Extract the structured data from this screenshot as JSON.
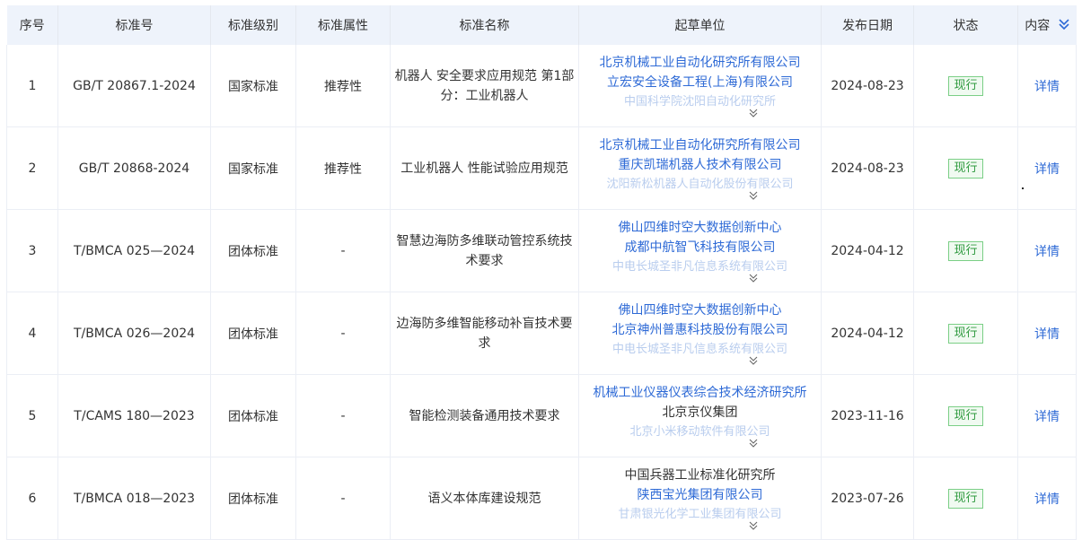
{
  "columns": [
    {
      "key": "index",
      "label": "序号"
    },
    {
      "key": "code",
      "label": "标准号"
    },
    {
      "key": "level",
      "label": "标准级别"
    },
    {
      "key": "attr",
      "label": "标准属性"
    },
    {
      "key": "name",
      "label": "标准名称"
    },
    {
      "key": "drafters",
      "label": "起草单位"
    },
    {
      "key": "date",
      "label": "发布日期"
    },
    {
      "key": "status",
      "label": "状态"
    },
    {
      "key": "content",
      "label": "内容"
    }
  ],
  "header_icon": "double-chevron-down-icon",
  "rows": [
    {
      "index": "1",
      "code": "GB/T 20867.1-2024",
      "level": "国家标准",
      "attr": "推荐性",
      "name": "机器人 安全要求应用规范 第1部分：工业机器人",
      "drafters": [
        "北京机械工业自动化研究所有限公司",
        "立宏安全设备工程(上海)有限公司",
        "中国科学院沈阳自动化研究所"
      ],
      "date": "2024-08-23",
      "status": "现行",
      "detail": "详情"
    },
    {
      "index": "2",
      "code": "GB/T 20868-2024",
      "level": "国家标准",
      "attr": "推荐性",
      "name": "工业机器人 性能试验应用规范",
      "drafters": [
        "北京机械工业自动化研究所有限公司",
        "重庆凯瑞机器人技术有限公司",
        "沈阳新松机器人自动化股份有限公司"
      ],
      "date": "2024-08-23",
      "status": "现行",
      "detail": "详情"
    },
    {
      "index": "3",
      "code": "T/BMCA 025—2024",
      "level": "团体标准",
      "attr": "-",
      "name": "智慧边海防多维联动管控系统技术要求",
      "drafters": [
        "佛山四维时空大数据创新中心",
        "成都中航智飞科技有限公司",
        "中电长城圣非凡信息系统有限公司"
      ],
      "date": "2024-04-12",
      "status": "现行",
      "detail": "详情"
    },
    {
      "index": "4",
      "code": "T/BMCA 026—2024",
      "level": "团体标准",
      "attr": "-",
      "name": "边海防多维智能移动补盲技术要求",
      "drafters": [
        "佛山四维时空大数据创新中心",
        "北京神州普惠科技股份有限公司",
        "中电长城圣非凡信息系统有限公司"
      ],
      "date": "2024-04-12",
      "status": "现行",
      "detail": "详情"
    },
    {
      "index": "5",
      "code": "T/CAMS 180—2023",
      "level": "团体标准",
      "attr": "-",
      "name": "智能检测装备通用技术要求",
      "drafters": [
        "机械工业仪器仪表综合技术经济研究所",
        "北京京仪集团",
        "北京小米移动软件有限公司"
      ],
      "date": "2023-11-16",
      "status": "现行",
      "detail": "详情"
    },
    {
      "index": "6",
      "code": "T/BMCA 018—2023",
      "level": "团体标准",
      "attr": "-",
      "name": "语义本体库建设规范",
      "drafters": [
        "中国兵器工业标准化研究所",
        "陕西宝光集团有限公司",
        "甘肃银光化学工业集团有限公司"
      ],
      "date": "2023-07-26",
      "status": "现行",
      "detail": "详情"
    }
  ],
  "colors": {
    "header_bg": "#eef3fb",
    "link": "#2e6ad6",
    "status_green": "#2f9a3f",
    "border": "#ebeef5"
  }
}
